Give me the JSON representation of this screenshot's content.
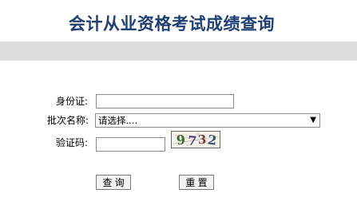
{
  "page": {
    "title": "会计从业资格考试成绩查询"
  },
  "form": {
    "id_label": "身份证:",
    "id_value": "",
    "batch_label": "批次名称:",
    "batch_selected": "请选择....",
    "captcha_label": "验证码:",
    "captcha_value": "",
    "captcha_image_text": "9732"
  },
  "buttons": {
    "query": "查  询",
    "reset": "重  置"
  },
  "colors": {
    "title": "#1f3f75",
    "band": "#dcdcdc"
  }
}
